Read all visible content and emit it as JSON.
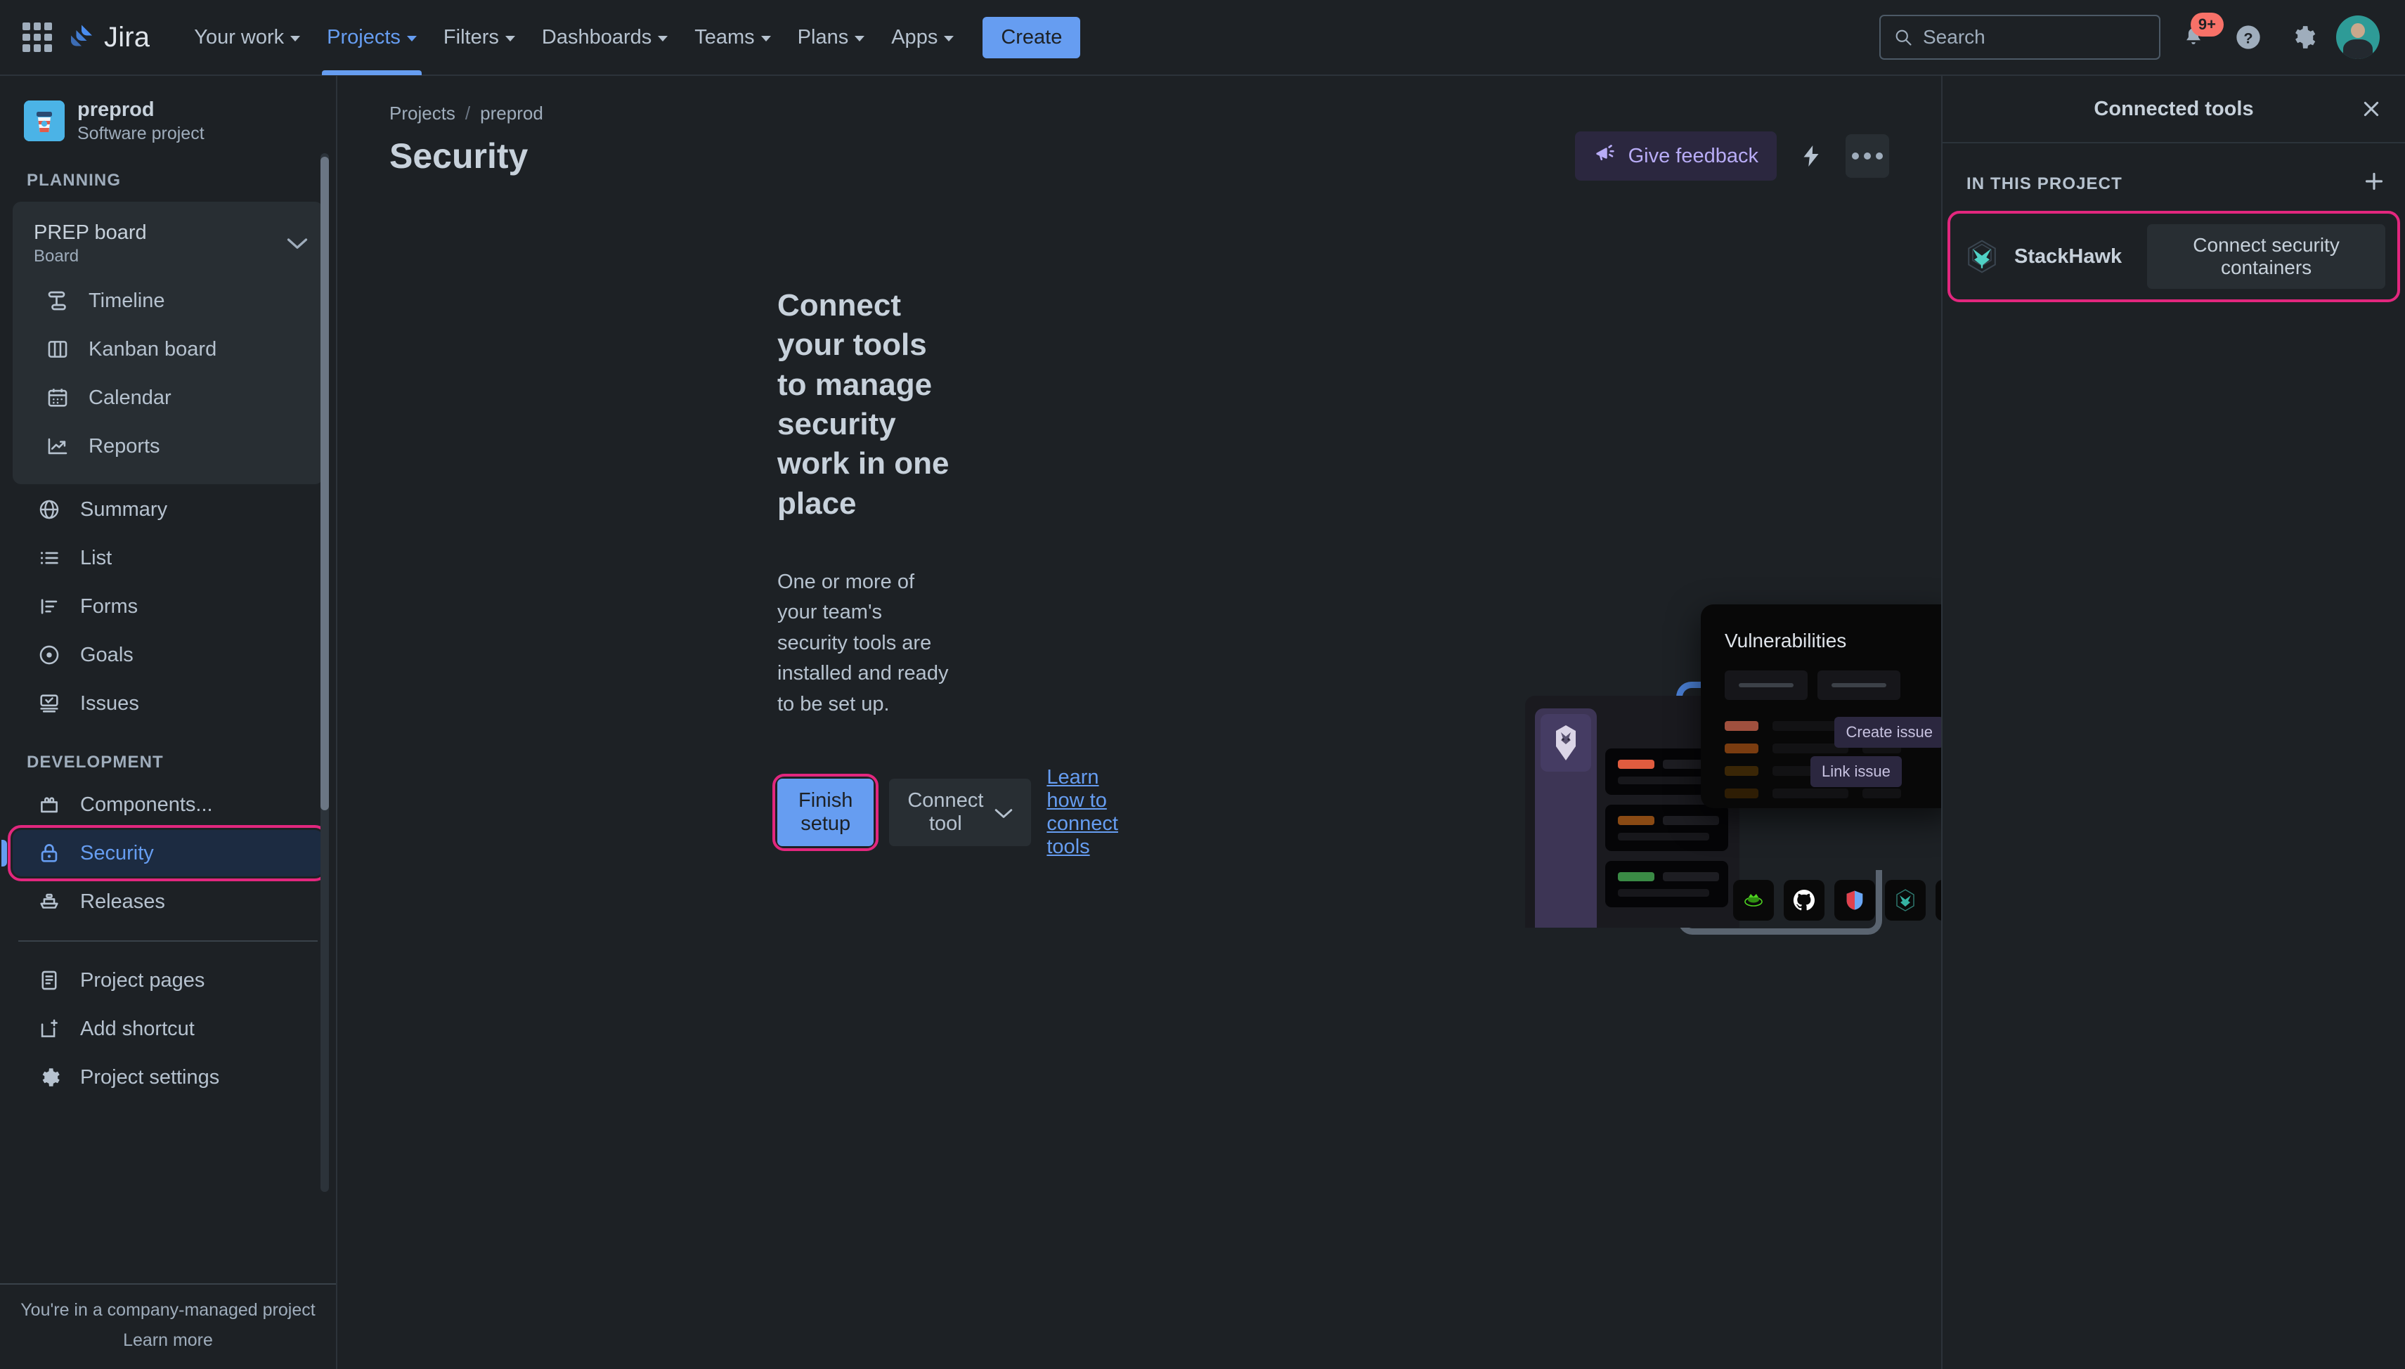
{
  "topnav": {
    "app_switcher_icon": "grid-icon",
    "brand": "Jira",
    "items": [
      {
        "label": "Your work",
        "has_chevron": true,
        "active": false
      },
      {
        "label": "Projects",
        "has_chevron": true,
        "active": true
      },
      {
        "label": "Filters",
        "has_chevron": true,
        "active": false
      },
      {
        "label": "Dashboards",
        "has_chevron": true,
        "active": false
      },
      {
        "label": "Teams",
        "has_chevron": true,
        "active": false
      },
      {
        "label": "Plans",
        "has_chevron": true,
        "active": false
      },
      {
        "label": "Apps",
        "has_chevron": true,
        "active": false
      }
    ],
    "create_label": "Create",
    "search_placeholder": "Search",
    "notification_badge": "9+",
    "icons": [
      "search-icon",
      "notifications-bell-icon",
      "help-icon",
      "settings-gear-icon",
      "user-avatar"
    ]
  },
  "sidebar": {
    "project": {
      "name": "preprod",
      "type": "Software project",
      "avatar_icon": "coffee-cup-icon"
    },
    "planning_label": "PLANNING",
    "board": {
      "name": "PREP board",
      "type": "Board",
      "chevron": "chevron-down-icon"
    },
    "board_items": [
      {
        "label": "Timeline",
        "icon": "timeline-icon"
      },
      {
        "label": "Kanban board",
        "icon": "board-columns-icon"
      },
      {
        "label": "Calendar",
        "icon": "calendar-icon"
      },
      {
        "label": "Reports",
        "icon": "reports-chart-icon"
      }
    ],
    "planning_items": [
      {
        "label": "Summary",
        "icon": "globe-icon"
      },
      {
        "label": "List",
        "icon": "list-icon"
      },
      {
        "label": "Forms",
        "icon": "forms-icon"
      },
      {
        "label": "Goals",
        "icon": "goals-target-icon"
      },
      {
        "label": "Issues",
        "icon": "issues-icon"
      }
    ],
    "development_label": "DEVELOPMENT",
    "development_items": [
      {
        "label": "Components...",
        "icon": "components-icon",
        "selected": false
      },
      {
        "label": "Security",
        "icon": "lock-icon",
        "selected": true
      },
      {
        "label": "Releases",
        "icon": "releases-ship-icon",
        "selected": false
      }
    ],
    "extra_items": [
      {
        "label": "Project pages",
        "icon": "page-icon"
      },
      {
        "label": "Add shortcut",
        "icon": "add-shortcut-icon"
      },
      {
        "label": "Project settings",
        "icon": "settings-gear-icon"
      }
    ],
    "footer": {
      "note": "You're in a company-managed project",
      "link": "Learn more"
    }
  },
  "main": {
    "breadcrumb": {
      "items": [
        "Projects",
        "preprod"
      ],
      "separator": "/"
    },
    "title": "Security",
    "feedback_label": "Give feedback",
    "feedback_icon": "megaphone-icon",
    "lightning_icon": "lightning-bolt-icon",
    "more_icon": "more-actions-icon",
    "empty_state": {
      "heading": "Connect your tools to manage security work in one place",
      "body": "One or more of your team's security tools are installed and ready to be set up.",
      "primary_button": "Finish setup",
      "secondary_button": "Connect tool",
      "secondary_chevron": "chevron-down-icon",
      "link": "Learn how to connect tools"
    },
    "illustration": {
      "card_title": "Vulnerabilities",
      "pill_create": "Create issue",
      "pill_link": "Link issue",
      "severity_colors": [
        "#a0503e",
        "#7a3c10",
        "#3a2606",
        "#2e1d04"
      ],
      "status_bar_colors": [
        "#e05c3f",
        "#8a4a14",
        "#3a8a45"
      ],
      "tool_icons": [
        "snyk-icon",
        "github-icon",
        "shield-icon",
        "stackhawk-icon",
        "mend-icon"
      ],
      "hawk_icon": "stackhawk-mascot-icon"
    }
  },
  "right_panel": {
    "title": "Connected tools",
    "close_icon": "close-icon",
    "section_label": "IN THIS PROJECT",
    "add_icon": "plus-icon",
    "tools": [
      {
        "name": "StackHawk",
        "logo_icon": "stackhawk-icon",
        "cta": "Connect security containers",
        "highlighted": true
      }
    ]
  },
  "colors": {
    "background": "#1d2125",
    "surface": "#282e33",
    "accent_blue": "#669df1",
    "selected_bg": "#1c2b41",
    "highlight_pink": "#e2277e",
    "text_primary": "#c7d1db",
    "text_secondary": "#9fadbc",
    "badge_red": "#f87168",
    "feedback_purple": "#b8acf6",
    "stackhawk_teal": "#4fd1c5"
  }
}
